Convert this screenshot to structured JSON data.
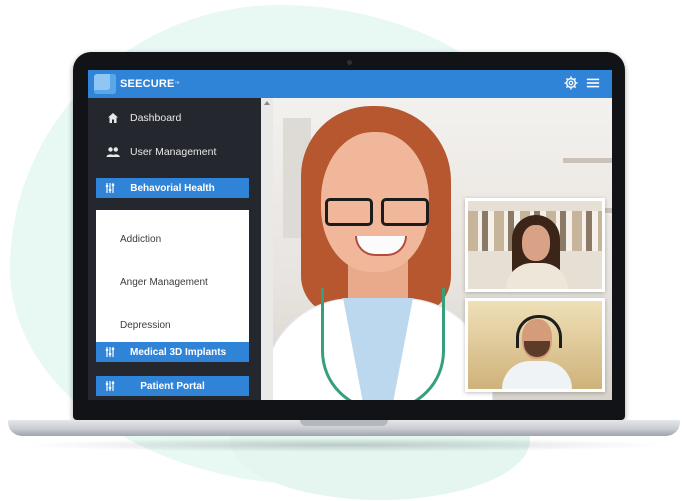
{
  "brand": {
    "name": "SEECURE",
    "tm": "™"
  },
  "topbar": {
    "settings_icon": "gear-icon",
    "menu_icon": "hamburger-menu-icon"
  },
  "sidebar": {
    "items": [
      {
        "label": "Dashboard",
        "icon": "home-icon"
      },
      {
        "label": "User Management",
        "icon": "users-icon"
      }
    ],
    "sections": [
      {
        "label": "Behavorial Health",
        "icon": "sliders-icon",
        "expanded": true
      },
      {
        "label": "Medical 3D Implants",
        "icon": "sliders-icon"
      },
      {
        "label": "Patient Portal",
        "icon": "sliders-icon"
      }
    ],
    "submenu": [
      {
        "label": "Addiction"
      },
      {
        "label": "Anger Management"
      },
      {
        "label": "Depression"
      }
    ]
  },
  "colors": {
    "accent": "#2f84d8",
    "sidebar_bg": "#24272d",
    "background_blob": "#e8f8f3"
  }
}
